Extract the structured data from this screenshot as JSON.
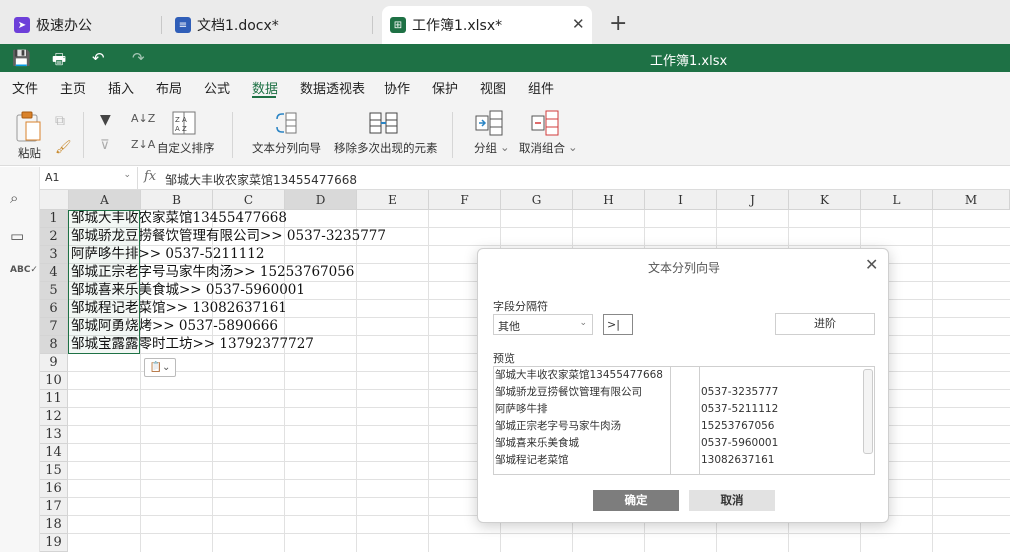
{
  "tabs": [
    {
      "label": "极速办公",
      "icon": "app-logo-icon",
      "color": "#6d3fd9"
    },
    {
      "label": "文档1.docx*",
      "icon": "word-doc-icon",
      "color": "#2f5eb8"
    },
    {
      "label": "工作簿1.xlsx*",
      "icon": "sheet-doc-icon",
      "color": "#1e7145"
    }
  ],
  "titlebar": {
    "title": "工作簿1.xlsx",
    "color": "#1e7145"
  },
  "menu": [
    "文件",
    "主页",
    "插入",
    "布局",
    "公式",
    "数据",
    "数据透视表",
    "协作",
    "保护",
    "视图",
    "组件"
  ],
  "active_menu": "数据",
  "ribbon": {
    "paste": "粘贴",
    "custom_sort": "自定义排序",
    "text_to_columns": "文本分列向导",
    "remove_duplicates": "移除多次出现的元素",
    "group": "分组",
    "ungroup": "取消组合"
  },
  "formula_bar": {
    "cell_ref": "A1",
    "fx": "fx",
    "content": "邹城大丰收农家菜馆13455477668"
  },
  "columns": [
    "A",
    "B",
    "C",
    "D",
    "E",
    "F",
    "G",
    "H",
    "I",
    "J",
    "K",
    "L",
    "M"
  ],
  "rows": [
    "1",
    "2",
    "3",
    "4",
    "5",
    "6",
    "7",
    "8",
    "9",
    "10",
    "11",
    "12",
    "13",
    "14",
    "15",
    "16",
    "17",
    "18",
    "19"
  ],
  "cells": [
    "邹城大丰收农家菜馆13455477668",
    "邹城骄龙豆捞餐饮管理有限公司>> 0537-3235777",
    "阿萨哆牛排>> 0537-5211112",
    "邹城正宗老字号马家牛肉汤>> 15253767056",
    "邹城喜来乐美食城>> 0537-5960001",
    "邹城程记老菜馆>> 13082637161",
    "邹城阿勇烧烤>> 0537-5890666",
    "邹城宝露露零时工坊>> 13792377727"
  ],
  "dialog": {
    "title": "文本分列向导",
    "delimiter_label": "字段分隔符",
    "delimiter_type": "其他",
    "delimiter_value": ">",
    "advanced": "进阶",
    "preview_label": "预览",
    "preview_rows": [
      [
        "邹城大丰收农家菜馆13455477668",
        "",
        ""
      ],
      [
        "邹城骄龙豆捞餐饮管理有限公司",
        "",
        "0537-3235777"
      ],
      [
        "阿萨哆牛排",
        "",
        "0537-5211112"
      ],
      [
        "邹城正宗老字号马家牛肉汤",
        "",
        "15253767056"
      ],
      [
        "邹城喜来乐美食城",
        "",
        "0537-5960001"
      ],
      [
        "邹城程记老菜馆",
        "",
        "13082637161"
      ]
    ],
    "ok": "确定",
    "cancel": "取消"
  }
}
